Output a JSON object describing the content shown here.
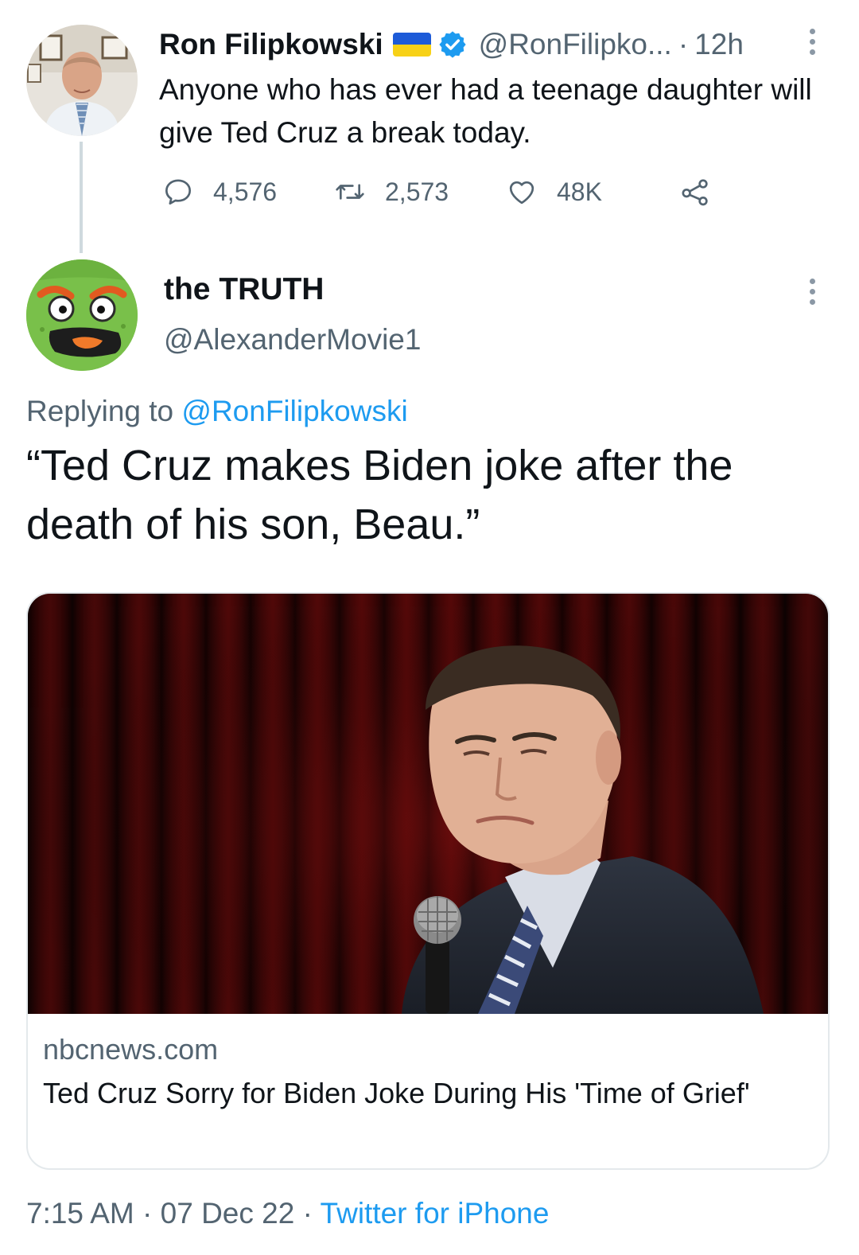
{
  "parent_tweet": {
    "display_name": "Ron Filipkowski",
    "handle": "@RonFilipko...",
    "separator": "·",
    "time_ago": "12h",
    "text": "Anyone who has ever had a teenage daughter will give Ted Cruz a break today.",
    "stats": {
      "replies": "4,576",
      "retweets": "2,573",
      "likes": "48K"
    },
    "flag_colors": {
      "top": "#1d5bd8",
      "bottom": "#f7d117"
    },
    "verified_color": "#1d9bf0",
    "icons": [
      "flag-ukraine-icon",
      "verified-badge-icon",
      "more-options-icon",
      "reply-icon",
      "retweet-icon",
      "like-icon",
      "share-icon"
    ]
  },
  "reply_tweet": {
    "display_name": "the TRUTH",
    "handle": "@AlexanderMovie1",
    "replying_prefix": "Replying to ",
    "replying_to": "@RonFilipkowski",
    "text": "“Ted Cruz makes Biden joke after the death of his son, Beau.”",
    "link_card": {
      "domain": "nbcnews.com",
      "title": "Ted Cruz Sorry for Biden Joke During His 'Time of Grief'"
    },
    "footer": {
      "time": "7:15 AM",
      "separator1": " · ",
      "date": "07 Dec 22",
      "separator2": " · ",
      "source": "Twitter for iPhone"
    }
  },
  "colors": {
    "text_primary": "#0f1419",
    "text_secondary": "#536471",
    "link": "#1d9bf0",
    "border": "#e4e9ec"
  }
}
